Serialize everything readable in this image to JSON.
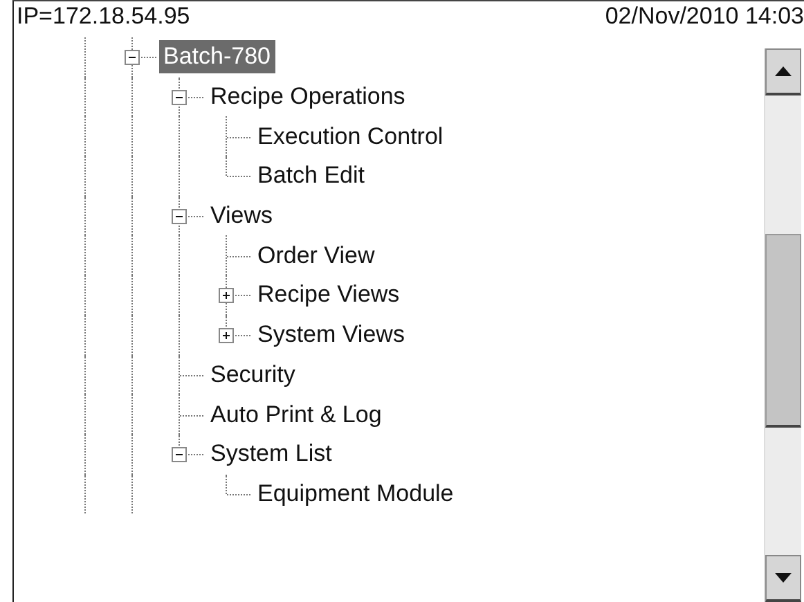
{
  "header": {
    "address": "IP=172.18.54.95",
    "datetime": "02/Nov/2010 14:03"
  },
  "tree": [
    {
      "label": "Batch-780",
      "selected": true,
      "expanded": true,
      "children": [
        {
          "label": "Recipe Operations",
          "selected": false,
          "expanded": true,
          "children": [
            {
              "label": "Execution Control",
              "selected": false
            },
            {
              "label": "Batch Edit",
              "selected": false
            }
          ]
        },
        {
          "label": "Views",
          "selected": false,
          "expanded": true,
          "children": [
            {
              "label": "Order View",
              "selected": false
            },
            {
              "label": "Recipe Views",
              "selected": false,
              "expanded": false
            },
            {
              "label": "System Views",
              "selected": false,
              "expanded": false
            }
          ]
        },
        {
          "label": "Security",
          "selected": false
        },
        {
          "label": "Auto Print & Log",
          "selected": false
        },
        {
          "label": "System List",
          "selected": false,
          "expanded": true,
          "children": [
            {
              "label": "Equipment Module",
              "selected": false
            }
          ]
        }
      ]
    }
  ]
}
